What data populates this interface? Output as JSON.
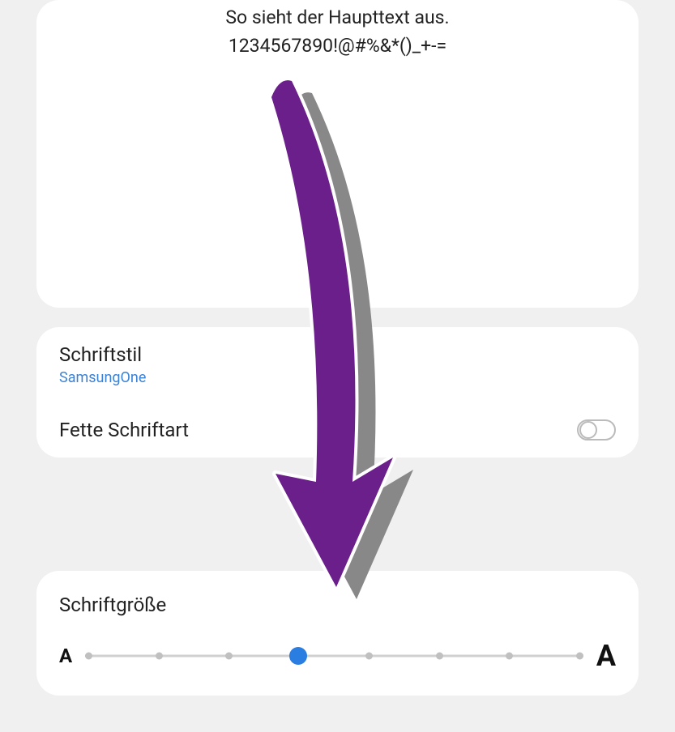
{
  "preview": {
    "line1": "So sieht der Haupttext aus.",
    "line2": "1234567890!@#%&*()_+-="
  },
  "settings": {
    "fontStyle": {
      "label": "Schriftstil",
      "value": "SamsungOne"
    },
    "boldFont": {
      "label": "Fette Schriftart",
      "enabled": false
    }
  },
  "fontSize": {
    "label": "Schriftgröße",
    "steps": 8,
    "current": 3,
    "thumbLeftPercent": "42.8%"
  }
}
